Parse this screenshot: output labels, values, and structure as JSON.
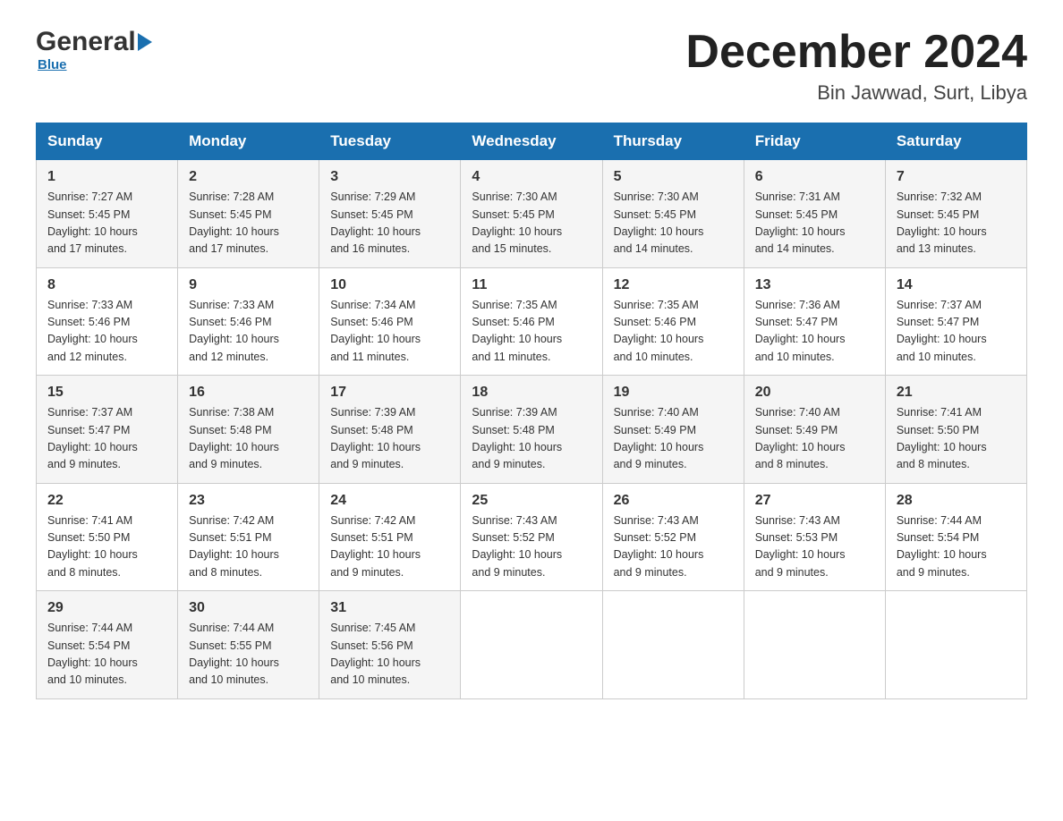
{
  "header": {
    "logo_general": "General",
    "logo_blue": "Blue",
    "month_title": "December 2024",
    "location": "Bin Jawwad, Surt, Libya"
  },
  "days_of_week": [
    "Sunday",
    "Monday",
    "Tuesday",
    "Wednesday",
    "Thursday",
    "Friday",
    "Saturday"
  ],
  "weeks": [
    [
      {
        "day": "1",
        "sunrise": "7:27 AM",
        "sunset": "5:45 PM",
        "daylight": "10 hours and 17 minutes."
      },
      {
        "day": "2",
        "sunrise": "7:28 AM",
        "sunset": "5:45 PM",
        "daylight": "10 hours and 17 minutes."
      },
      {
        "day": "3",
        "sunrise": "7:29 AM",
        "sunset": "5:45 PM",
        "daylight": "10 hours and 16 minutes."
      },
      {
        "day": "4",
        "sunrise": "7:30 AM",
        "sunset": "5:45 PM",
        "daylight": "10 hours and 15 minutes."
      },
      {
        "day": "5",
        "sunrise": "7:30 AM",
        "sunset": "5:45 PM",
        "daylight": "10 hours and 14 minutes."
      },
      {
        "day": "6",
        "sunrise": "7:31 AM",
        "sunset": "5:45 PM",
        "daylight": "10 hours and 14 minutes."
      },
      {
        "day": "7",
        "sunrise": "7:32 AM",
        "sunset": "5:45 PM",
        "daylight": "10 hours and 13 minutes."
      }
    ],
    [
      {
        "day": "8",
        "sunrise": "7:33 AM",
        "sunset": "5:46 PM",
        "daylight": "10 hours and 12 minutes."
      },
      {
        "day": "9",
        "sunrise": "7:33 AM",
        "sunset": "5:46 PM",
        "daylight": "10 hours and 12 minutes."
      },
      {
        "day": "10",
        "sunrise": "7:34 AM",
        "sunset": "5:46 PM",
        "daylight": "10 hours and 11 minutes."
      },
      {
        "day": "11",
        "sunrise": "7:35 AM",
        "sunset": "5:46 PM",
        "daylight": "10 hours and 11 minutes."
      },
      {
        "day": "12",
        "sunrise": "7:35 AM",
        "sunset": "5:46 PM",
        "daylight": "10 hours and 10 minutes."
      },
      {
        "day": "13",
        "sunrise": "7:36 AM",
        "sunset": "5:47 PM",
        "daylight": "10 hours and 10 minutes."
      },
      {
        "day": "14",
        "sunrise": "7:37 AM",
        "sunset": "5:47 PM",
        "daylight": "10 hours and 10 minutes."
      }
    ],
    [
      {
        "day": "15",
        "sunrise": "7:37 AM",
        "sunset": "5:47 PM",
        "daylight": "10 hours and 9 minutes."
      },
      {
        "day": "16",
        "sunrise": "7:38 AM",
        "sunset": "5:48 PM",
        "daylight": "10 hours and 9 minutes."
      },
      {
        "day": "17",
        "sunrise": "7:39 AM",
        "sunset": "5:48 PM",
        "daylight": "10 hours and 9 minutes."
      },
      {
        "day": "18",
        "sunrise": "7:39 AM",
        "sunset": "5:48 PM",
        "daylight": "10 hours and 9 minutes."
      },
      {
        "day": "19",
        "sunrise": "7:40 AM",
        "sunset": "5:49 PM",
        "daylight": "10 hours and 9 minutes."
      },
      {
        "day": "20",
        "sunrise": "7:40 AM",
        "sunset": "5:49 PM",
        "daylight": "10 hours and 8 minutes."
      },
      {
        "day": "21",
        "sunrise": "7:41 AM",
        "sunset": "5:50 PM",
        "daylight": "10 hours and 8 minutes."
      }
    ],
    [
      {
        "day": "22",
        "sunrise": "7:41 AM",
        "sunset": "5:50 PM",
        "daylight": "10 hours and 8 minutes."
      },
      {
        "day": "23",
        "sunrise": "7:42 AM",
        "sunset": "5:51 PM",
        "daylight": "10 hours and 8 minutes."
      },
      {
        "day": "24",
        "sunrise": "7:42 AM",
        "sunset": "5:51 PM",
        "daylight": "10 hours and 9 minutes."
      },
      {
        "day": "25",
        "sunrise": "7:43 AM",
        "sunset": "5:52 PM",
        "daylight": "10 hours and 9 minutes."
      },
      {
        "day": "26",
        "sunrise": "7:43 AM",
        "sunset": "5:52 PM",
        "daylight": "10 hours and 9 minutes."
      },
      {
        "day": "27",
        "sunrise": "7:43 AM",
        "sunset": "5:53 PM",
        "daylight": "10 hours and 9 minutes."
      },
      {
        "day": "28",
        "sunrise": "7:44 AM",
        "sunset": "5:54 PM",
        "daylight": "10 hours and 9 minutes."
      }
    ],
    [
      {
        "day": "29",
        "sunrise": "7:44 AM",
        "sunset": "5:54 PM",
        "daylight": "10 hours and 10 minutes."
      },
      {
        "day": "30",
        "sunrise": "7:44 AM",
        "sunset": "5:55 PM",
        "daylight": "10 hours and 10 minutes."
      },
      {
        "day": "31",
        "sunrise": "7:45 AM",
        "sunset": "5:56 PM",
        "daylight": "10 hours and 10 minutes."
      },
      null,
      null,
      null,
      null
    ]
  ],
  "labels": {
    "sunrise": "Sunrise:",
    "sunset": "Sunset:",
    "daylight": "Daylight:"
  }
}
